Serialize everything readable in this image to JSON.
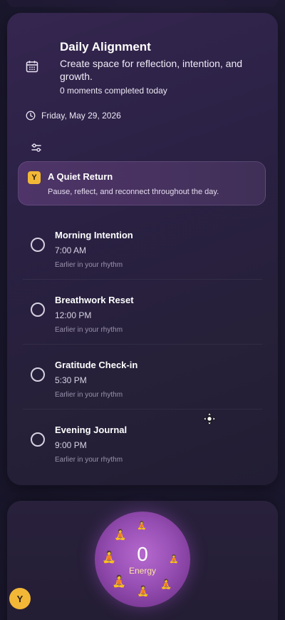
{
  "header": {
    "title": "Daily Alignment",
    "subtitle": "Create space for reflection, intention, and growth.",
    "count": "0 moments completed today"
  },
  "date": {
    "label": "Friday, May 29, 2026"
  },
  "banner": {
    "badge": "Y",
    "title": "A Quiet Return",
    "description": "Pause, reflect, and reconnect throughout the day."
  },
  "moments": [
    {
      "title": "Morning Intention",
      "time": "7:00 AM",
      "note": "Earlier in your rhythm"
    },
    {
      "title": "Breathwork Reset",
      "time": "12:00 PM",
      "note": "Earlier in your rhythm"
    },
    {
      "title": "Gratitude Check-in",
      "time": "5:30 PM",
      "note": "Earlier in your rhythm"
    },
    {
      "title": "Evening Journal",
      "time": "9:00 PM",
      "note": "Earlier in your rhythm"
    }
  ],
  "energy": {
    "value": "0",
    "label": "Energy"
  },
  "avatar": {
    "initial": "Y"
  },
  "icons": {
    "calendar": "calendar-icon",
    "clock": "clock-icon",
    "filter": "sliders-icon",
    "meditation": "meditation-icon",
    "move": "move-cursor-icon"
  },
  "colors": {
    "accent_yellow": "#f2b737",
    "orb_purple": "#9b52b8",
    "banner_bg": "#4e3468",
    "card_bg": "#2b2145"
  }
}
